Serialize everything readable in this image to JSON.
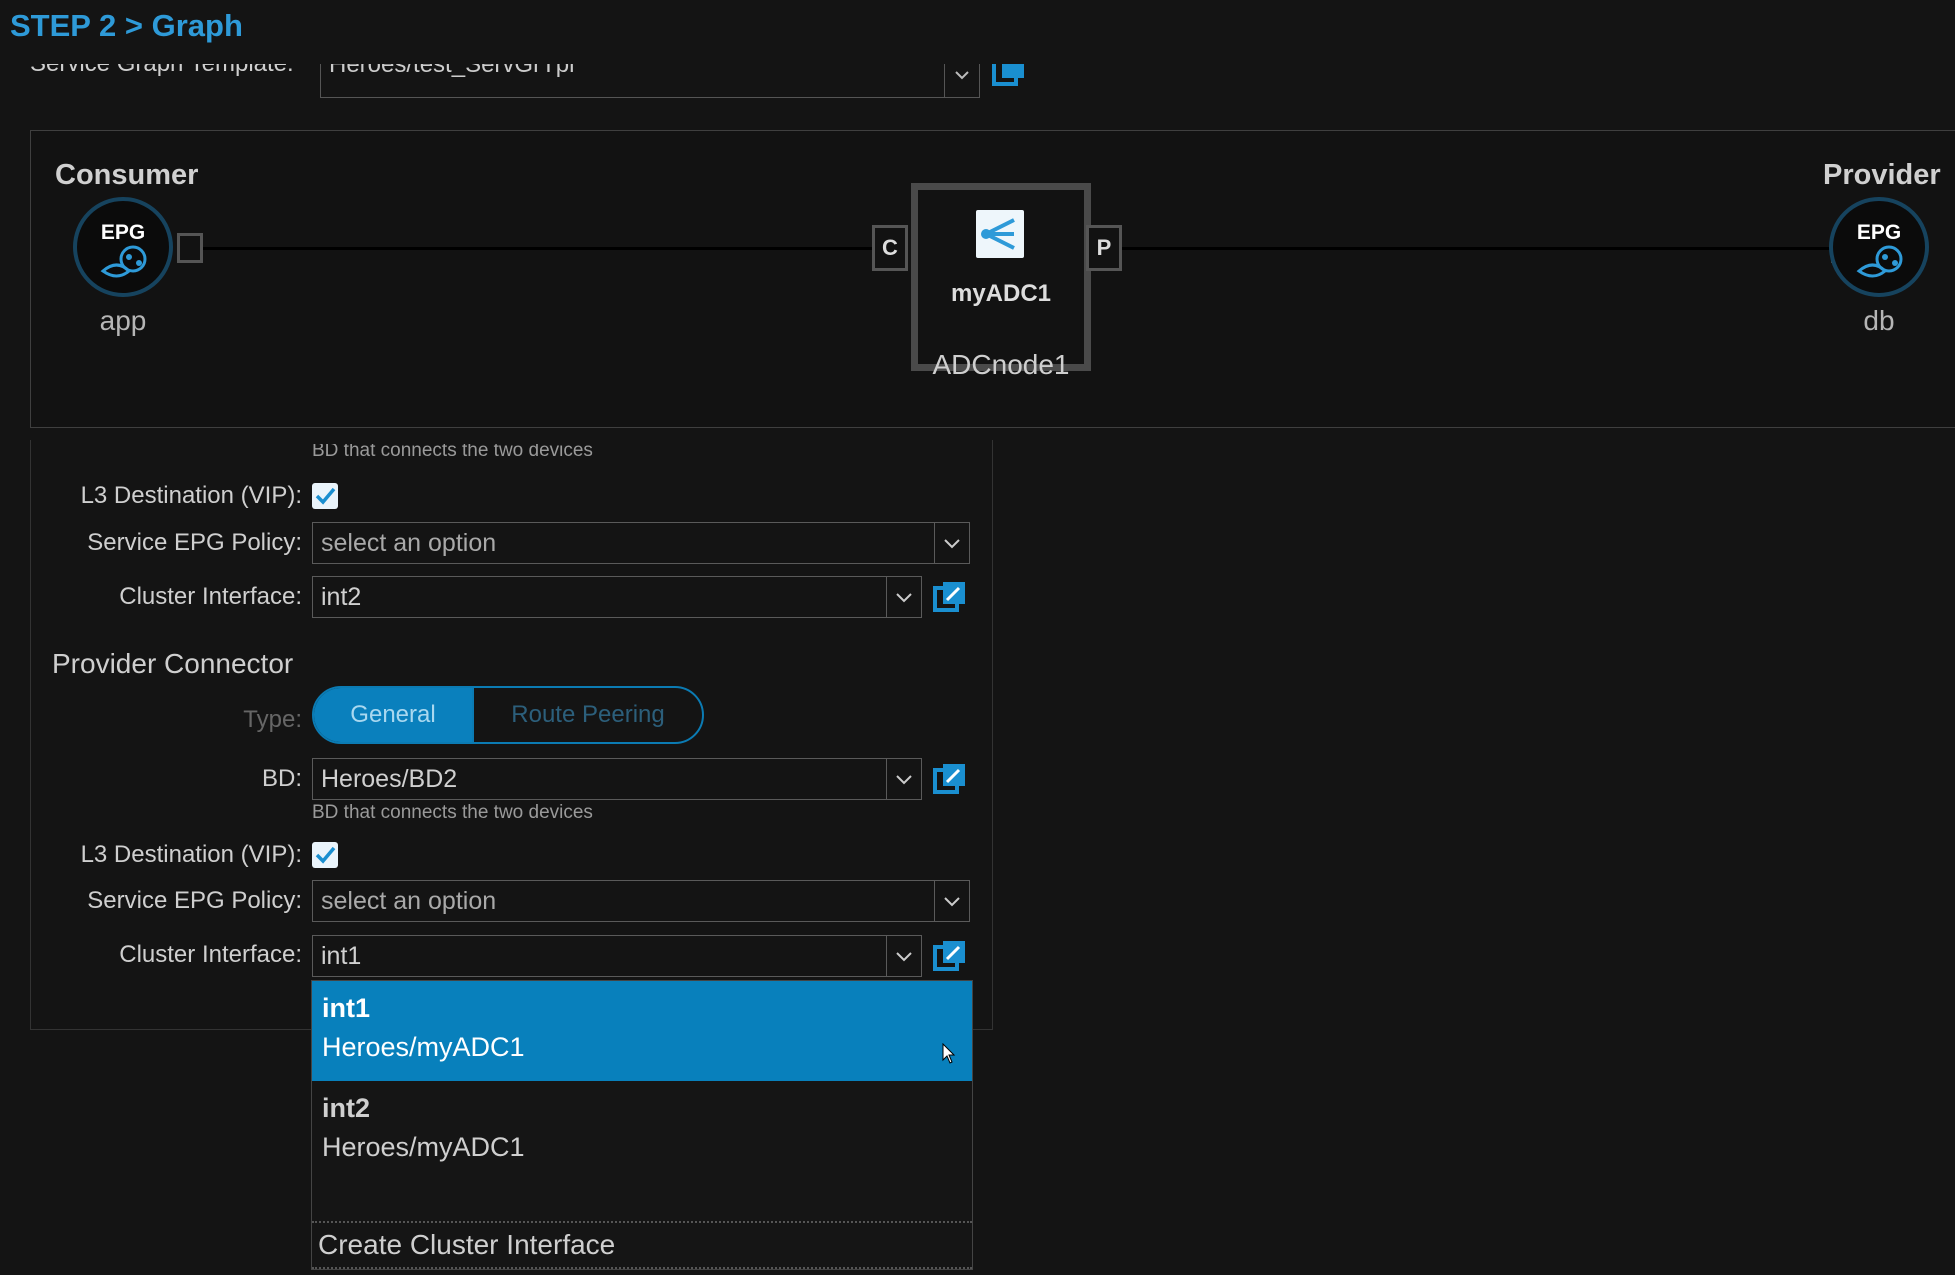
{
  "step_title": "STEP 2 > Graph",
  "template": {
    "label": "Service Graph Template:",
    "value": "Heroes/test_ServGrTpl"
  },
  "graph": {
    "consumer": {
      "title": "Consumer",
      "badge": "EPG",
      "name": "app"
    },
    "provider": {
      "title": "Provider",
      "badge": "EPG",
      "name": "db"
    },
    "node": {
      "device": "myADC1",
      "name": "ADCnode1",
      "consumer_port": "C",
      "provider_port": "P"
    }
  },
  "consumer_connector": {
    "bd_hint": "BD that connects the two devices",
    "l3_label": "L3 Destination (VIP):",
    "l3_checked": true,
    "epg_policy_label": "Service EPG Policy:",
    "epg_policy_placeholder": "select an option",
    "cluster_label": "Cluster Interface:",
    "cluster_value": "int2"
  },
  "provider_connector": {
    "title": "Provider Connector",
    "type_label": "Type:",
    "type_options": [
      "General",
      "Route Peering"
    ],
    "type_selected": "General",
    "bd_label": "BD:",
    "bd_value": "Heroes/BD2",
    "bd_hint": "BD that connects the two devices",
    "l3_label": "L3 Destination (VIP):",
    "l3_checked": true,
    "epg_policy_label": "Service EPG Policy:",
    "epg_policy_placeholder": "select an option",
    "cluster_label": "Cluster Interface:",
    "cluster_value": "int1"
  },
  "cluster_dropdown": {
    "options": [
      {
        "name": "int1",
        "device": "Heroes/myADC1",
        "highlighted": true
      },
      {
        "name": "int2",
        "device": "Heroes/myADC1",
        "highlighted": false
      }
    ],
    "create_label": "Create Cluster Interface"
  },
  "colors": {
    "accent": "#0880bc",
    "title": "#2e9ad8",
    "background": "#141414"
  }
}
